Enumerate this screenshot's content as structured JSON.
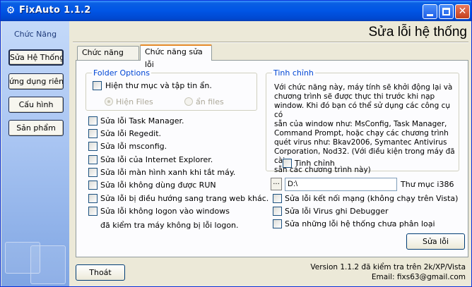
{
  "window": {
    "title": "FixAuto 1.1.2",
    "icon": "gear-icon",
    "titlebar_color": "#0055e5"
  },
  "sidebar": {
    "title": "Chức Năng",
    "items": [
      {
        "label": "Sửa Hệ Thống"
      },
      {
        "label": "ứng dụng riêng"
      },
      {
        "label": "Cấu hình"
      },
      {
        "label": "Sản phẩm"
      }
    ]
  },
  "header": {
    "title": "Sửa lỗi hệ thống"
  },
  "tabs": [
    {
      "label": "Chức năng khóa",
      "active": false
    },
    {
      "label": "Chức năng sửa lỗi",
      "active": true
    }
  ],
  "folder_options": {
    "legend": "Folder Options",
    "show_hidden": {
      "label": "Hiện thư mục và tập tin ẩn.",
      "checked": false
    },
    "radios": [
      {
        "label": "Hiện Files",
        "selected": true,
        "disabled": true
      },
      {
        "label": "ẩn files",
        "selected": false,
        "disabled": true
      }
    ]
  },
  "fix_options": [
    {
      "label": "Sửa lỗi Task Manager.",
      "checked": false
    },
    {
      "label": "Sửa lỗi Regedit.",
      "checked": false
    },
    {
      "label": "Sửa lỗi msconfig.",
      "checked": false
    },
    {
      "label": "Sửa lỗi của Internet Explorer.",
      "checked": false
    },
    {
      "label": "Sửa lỗi màn hình xanh khi tắt máy.",
      "checked": false
    },
    {
      "label": "Sửa lỗi không dùng được RUN",
      "checked": false
    },
    {
      "label": "Sửa lỗi bị điều hướng sang trang web khác.",
      "checked": false
    },
    {
      "label": "Sửa lỗi không logon vào windows",
      "checked": false
    }
  ],
  "logon_note": "đã kiểm tra máy không bị lỗi logon.",
  "tinh_chinh": {
    "legend": "Tinh chỉnh",
    "description_lines": [
      "Với chức năng này, máy tính sẽ khởi động lại và",
      "chương trình sẽ được thực thi trước khi nạp",
      "window. Khi đó bạn có thể sử dụng các công cụ có",
      "sẵn của window như: MsConfig, Task Manager,",
      "Command Prompt, hoặc chạy các chương trình",
      "quét virus như: Bkav2006, Symantec Antivirus",
      "Corporation, Nod32. (Với điều kiện trong máy đã cài",
      "sẵn các chương trình này)"
    ],
    "checkbox": {
      "label": "Tinh chỉnh",
      "checked": false
    }
  },
  "i386": {
    "browse_label": "...",
    "path_value": "D:\\",
    "folder_label": "Thư mục i386"
  },
  "extra_options": [
    {
      "label": "Sửa lỗi kết nối mạng (không chạy trên Vista)",
      "checked": false
    },
    {
      "label": "Sửa lỗi Virus ghi Debugger",
      "checked": false
    },
    {
      "label": "Sửa những lỗi hệ thống chưa phân loại",
      "checked": false
    }
  ],
  "fix_button": "Sửa lỗi",
  "exit_button": "Thoát",
  "footer": {
    "version": "Version 1.1.2 đã kiểm tra trên 2k/XP/Vista",
    "email": "Email: fixs63@gmail.com"
  }
}
